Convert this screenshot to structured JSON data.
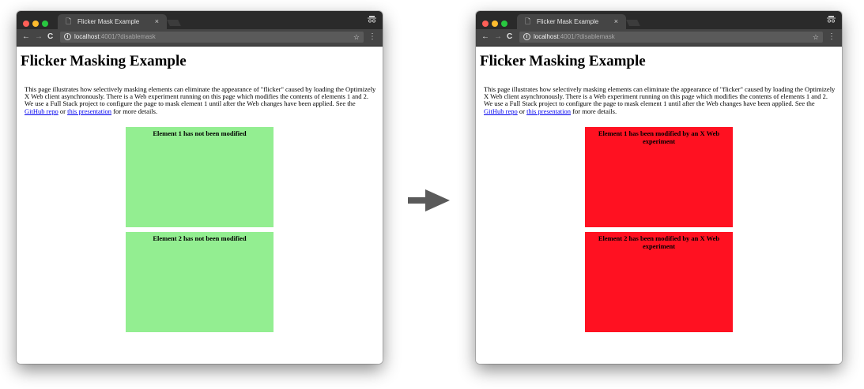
{
  "colors": {
    "unmodified": "#93ee91",
    "modified": "#ff1121",
    "arrow": "#5a5a5a",
    "link": "#0000ee"
  },
  "browser": {
    "tab_title": "Flicker Mask Example",
    "tab_close": "×",
    "url_host": "localhost",
    "url_path": ":4001/?disablemask",
    "icons": {
      "back": "←",
      "forward": "→",
      "reload": "C",
      "info": "i",
      "star": "☆",
      "menu": "⋮",
      "page": "🗋",
      "incognito": "incognito-icon"
    }
  },
  "page": {
    "heading": "Flicker Masking Example",
    "intro_before": "This page illustrates how selectively masking elements can eliminate the appearance of \"flicker\" caused by loading the Optimizely X Web client asynchronously. There is a Web experiment running on this page which modifies the contents of elements 1 and 2. We use a Full Stack project to configure the page to mask element 1 until after the Web changes have been applied. See the ",
    "link_repo": "GitHub repo",
    "intro_between": " or ",
    "link_presentation": "this presentation",
    "intro_after": " for more details."
  },
  "before": {
    "element1": "Element 1 has not been modified",
    "element2": "Element 2 has not been modified"
  },
  "after": {
    "element1": "Element 1 has been modified by an X Web experiment",
    "element2": "Element 2 has been modified by an X Web experiment"
  }
}
